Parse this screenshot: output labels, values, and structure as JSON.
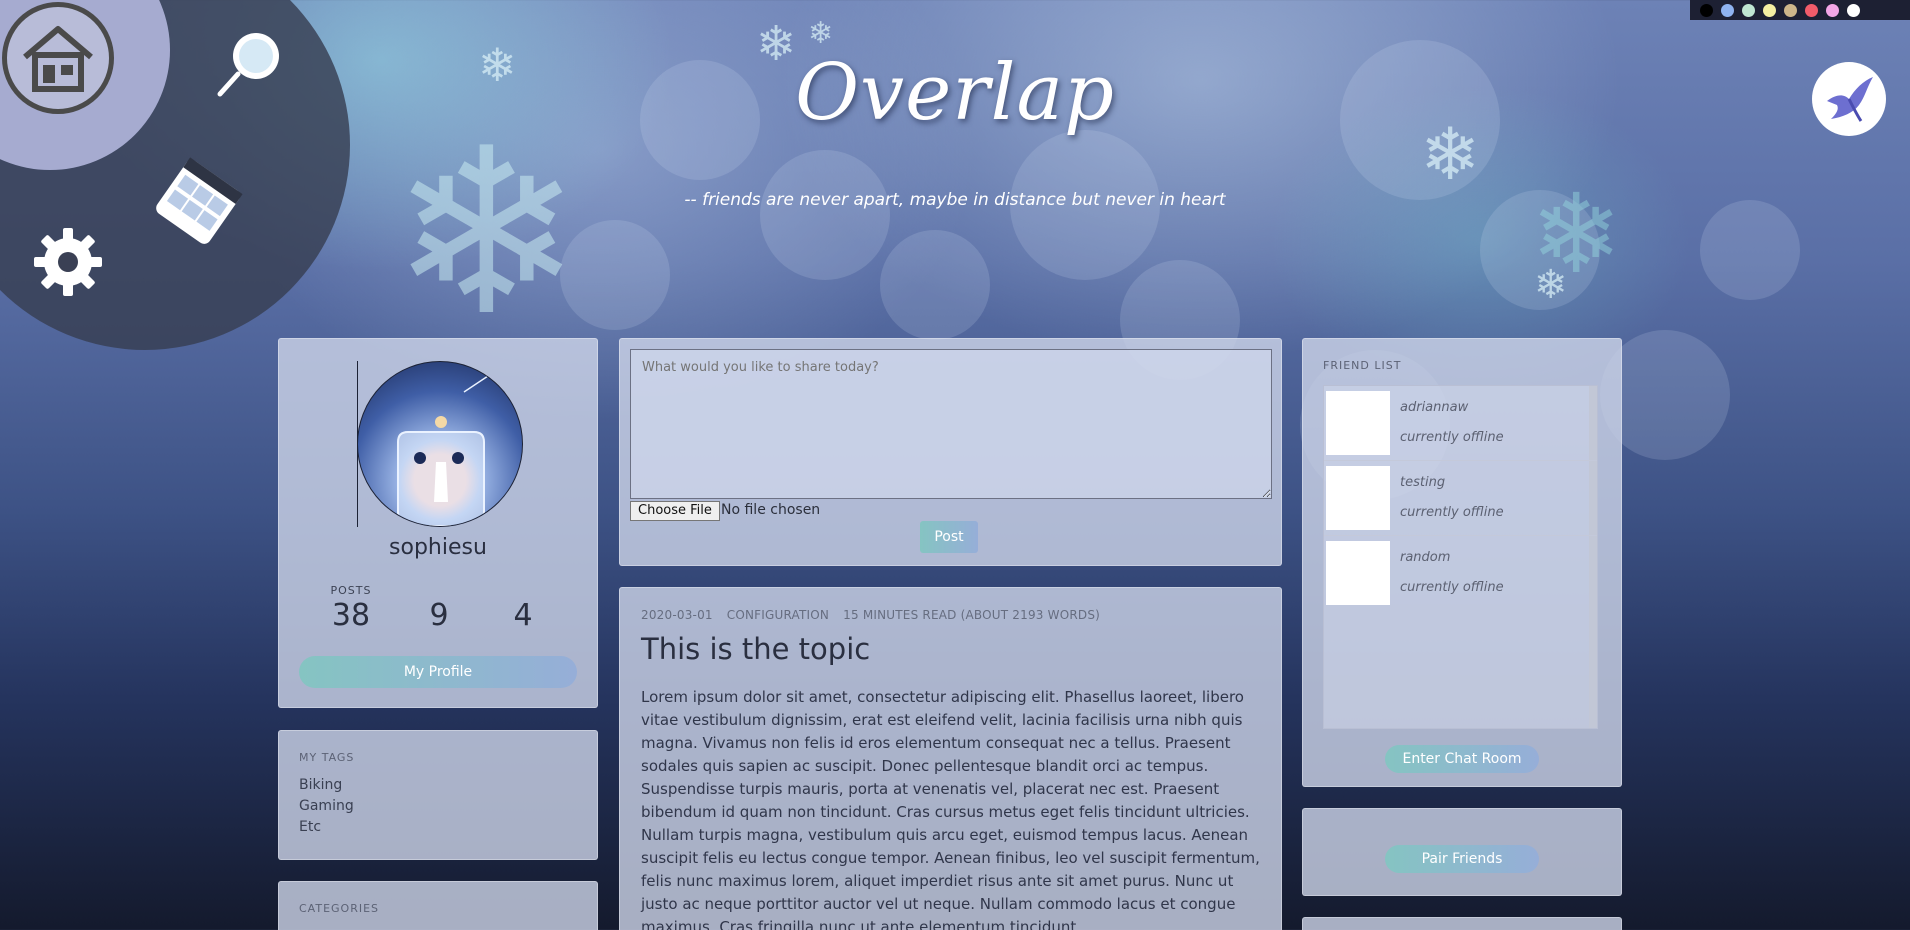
{
  "header": {
    "title": "Overlap",
    "tagline": "-- friends are never apart, maybe in distance but never in heart"
  },
  "nav": {
    "home_icon": "home-icon",
    "search_icon": "search-icon",
    "calendar_icon": "calendar-icon",
    "settings_icon": "gear-icon",
    "brand_icon": "bird-icon"
  },
  "theme_palette": [
    "#000000",
    "#8fb3f0",
    "#bfe6d2",
    "#f4efa2",
    "#cdb68a",
    "#f25c6a",
    "#f3a6e6",
    "#ffffff"
  ],
  "profile": {
    "username": "sophiesu",
    "stats": [
      {
        "label": "POSTS",
        "value": "38"
      },
      {
        "label": "",
        "value": "9"
      },
      {
        "label": "",
        "value": "4"
      }
    ],
    "profile_button": "My Profile"
  },
  "tags": {
    "heading": "MY TAGS",
    "items": [
      "Biking",
      "Gaming",
      "Etc"
    ]
  },
  "categories": {
    "heading": "CATEGORIES"
  },
  "composer": {
    "placeholder": "What would you like to share today?",
    "file_button": "Choose File",
    "file_status": "No file chosen",
    "post_button": "Post"
  },
  "post": {
    "date": "2020-03-01",
    "category": "CONFIGURATION",
    "read_time": "15 MINUTES READ (ABOUT 2193 WORDS)",
    "title": "This is the topic",
    "body": "Lorem ipsum dolor sit amet, consectetur adipiscing elit. Phasellus laoreet, libero vitae vestibulum dignissim, erat est eleifend velit, lacinia facilisis urna nibh quis magna. Vivamus non felis id eros elementum consequat nec a tellus. Praesent sodales quis sapien ac suscipit. Donec pellentesque blandit orci ac tempus. Suspendisse turpis mauris, porta at venenatis vel, placerat nec est. Praesent bibendum id quam non tincidunt. Cras cursus metus eget felis tincidunt ultricies. Nullam turpis magna, vestibulum quis arcu eget, euismod tempus lacus. Aenean suscipit felis eu lectus congue tempor. Aenean finibus, leo vel suscipit fermentum, felis nunc maximus lorem, aliquet imperdiet risus ante sit amet purus. Nunc ut justo ac neque porttitor auctor vel ut neque. Nullam commodo lacus et congue maximus. Cras fringilla nunc ut ante elementum tincidunt"
  },
  "friends": {
    "heading": "FRIEND LIST",
    "items": [
      {
        "name": "adriannaw",
        "status": "currently offline"
      },
      {
        "name": "testing",
        "status": "currently offline"
      },
      {
        "name": "random",
        "status": "currently offline"
      }
    ],
    "chat_button": "Enter Chat Room",
    "pair_button": "Pair Friends"
  }
}
